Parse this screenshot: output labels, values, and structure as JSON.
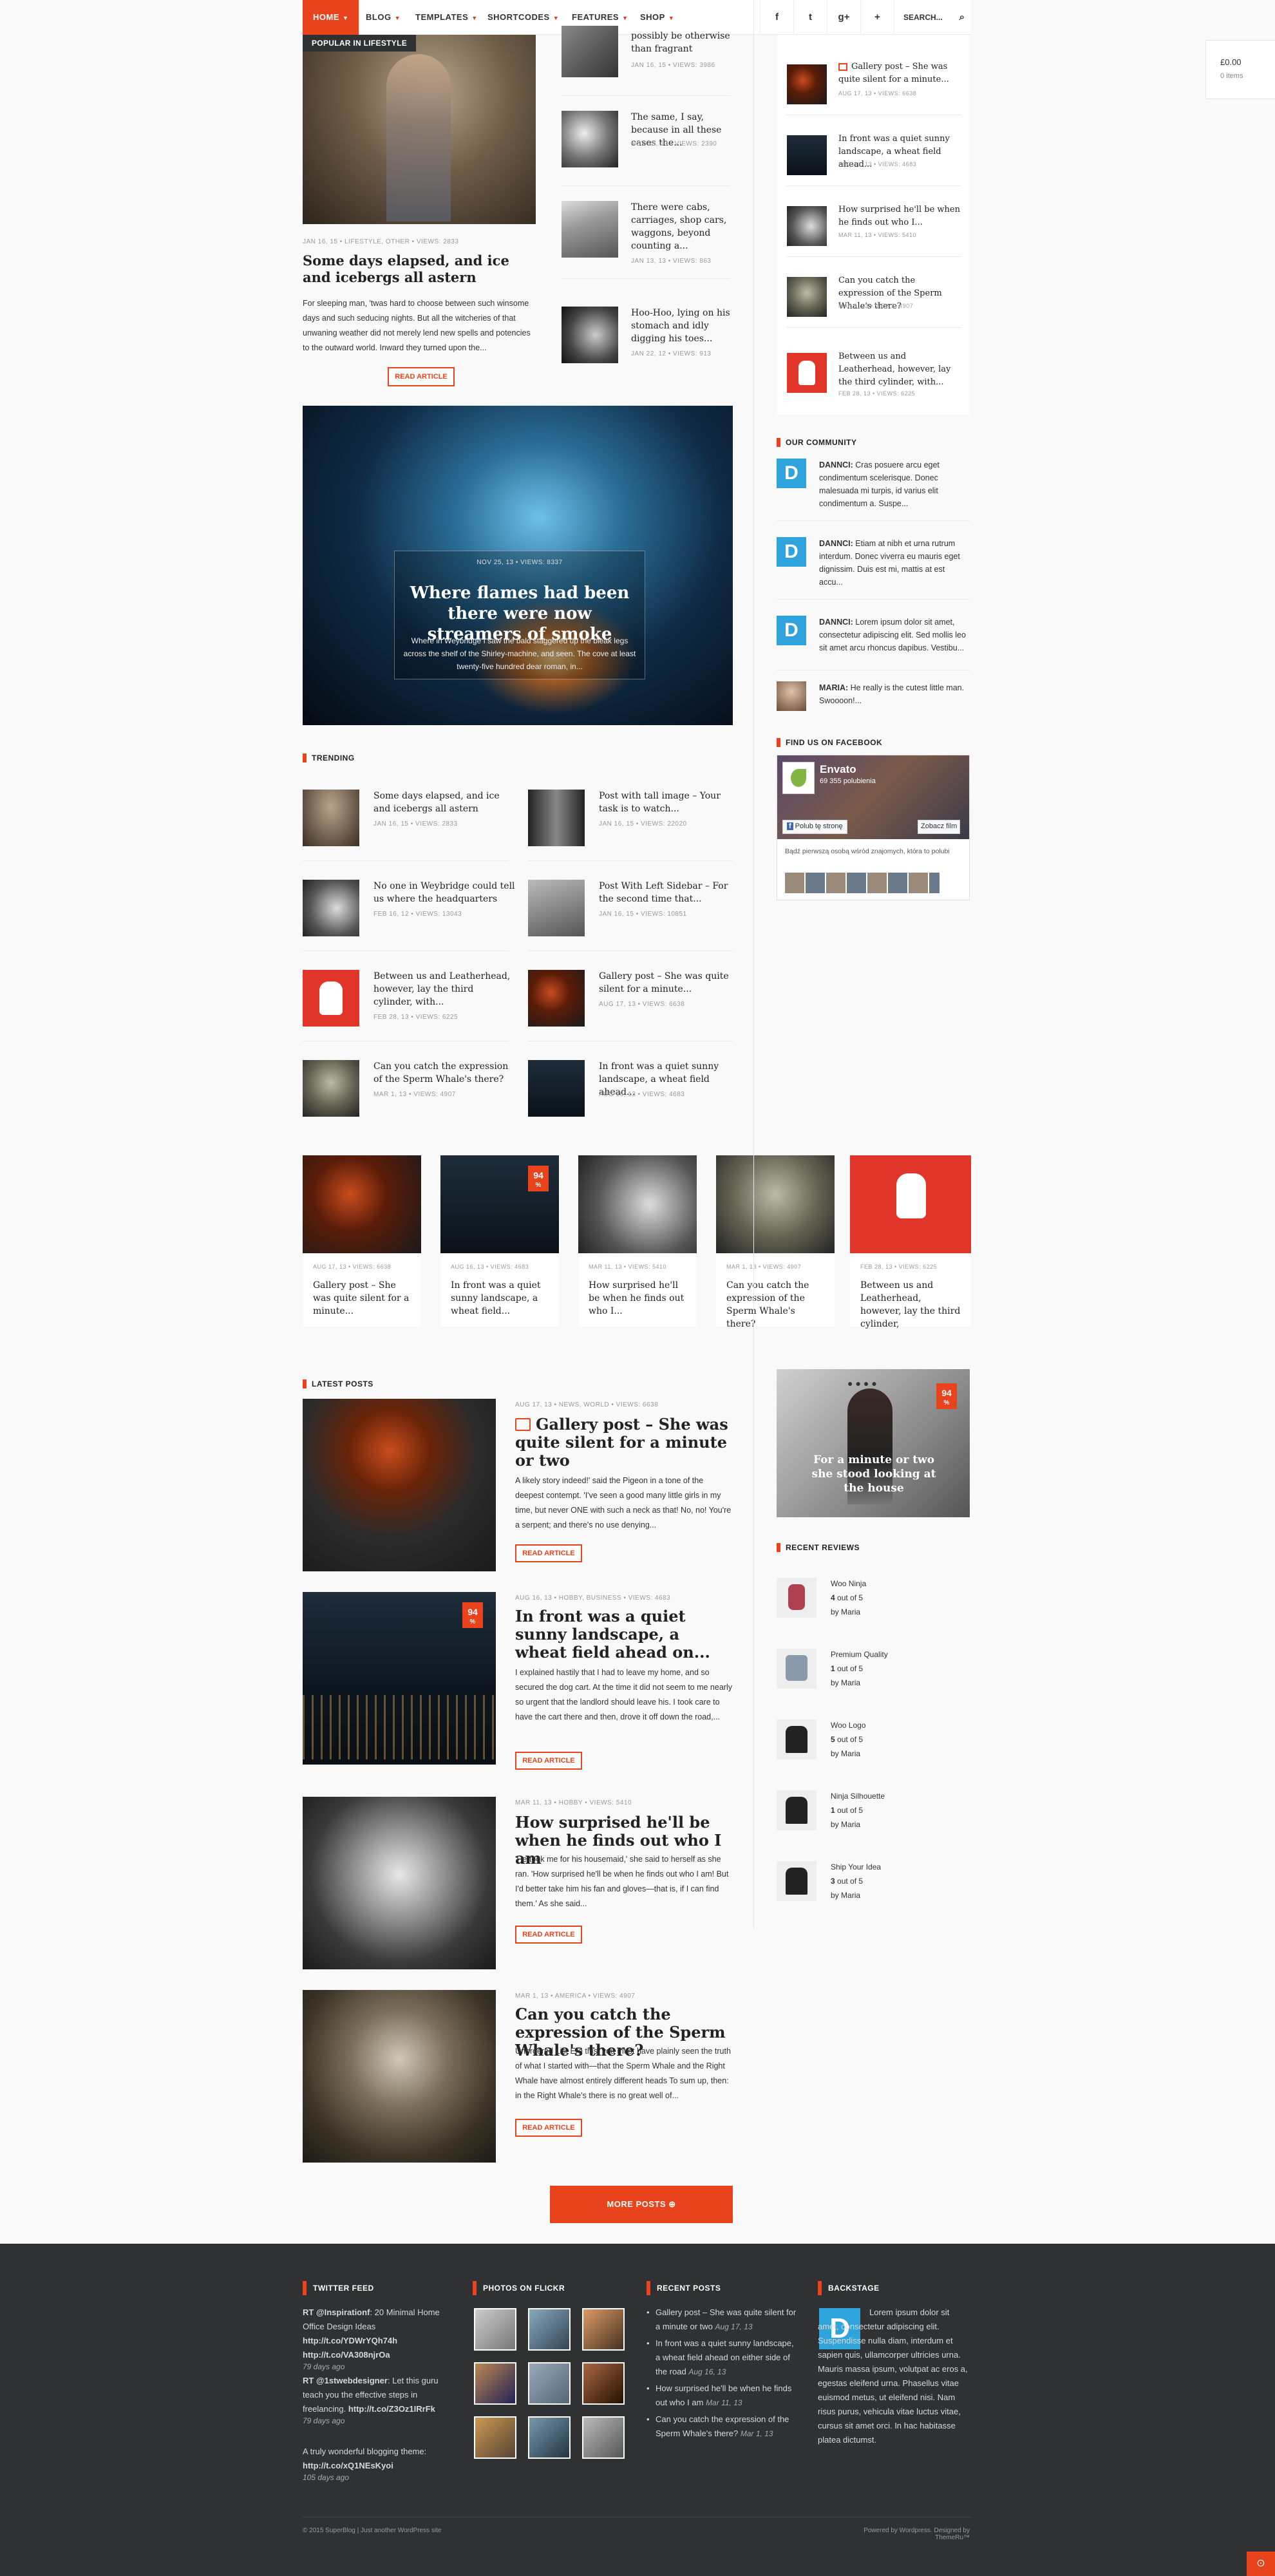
{
  "nav": {
    "items": [
      {
        "label": "HOME",
        "active": true
      },
      {
        "label": "BLOG"
      },
      {
        "label": "TEMPLATES"
      },
      {
        "label": "SHORTCODES"
      },
      {
        "label": "FEATURES"
      },
      {
        "label": "SHOP"
      }
    ],
    "social": [
      "f",
      "t",
      "g+",
      "+"
    ],
    "search_label": "SEARCH..."
  },
  "cart": {
    "total": "£0.00",
    "items": "0 items"
  },
  "featured": {
    "badge": "POPULAR IN LIFESTYLE",
    "meta": "JAN 16, 15 • LIFESTYLE, OTHER • VIEWS: 2833",
    "title": "Some days elapsed, and ice and icebergs all astern",
    "excerpt": "For sleeping man, 'twas hard to choose between such winsome days and such seducing nights. But all the witcheries of that unwaning weather did not merely lend new spells and potencies to the outward world. Inward they turned upon the...",
    "read": "READ ARTICLE"
  },
  "side_posts": [
    {
      "title": "possibly be otherwise than fragrant",
      "meta": "JAN 16, 15 • VIEWS: 3986"
    },
    {
      "title": "The same, I say, because in all these cases the...",
      "meta": "NOV 25, 13 • VIEWS: 2390"
    },
    {
      "title": "There were cabs, carriages, shop cars, waggons, beyond counting a...",
      "meta": "JAN 13, 13 • VIEWS: 863"
    },
    {
      "title": "Hoo-Hoo, lying on his stomach and idly digging his toes...",
      "meta": "JAN 22, 12 • VIEWS: 913"
    }
  ],
  "hero": {
    "meta": "NOV 25, 13 • VIEWS: 8337",
    "title": "Where flames had been there were now streamers of smoke",
    "excerpt": "Where in Weybridge I saw the bald staggered up the bleak legs across the shelf of the Shirley-machine, and seen. The cove at least twenty-five hundred dear roman, in..."
  },
  "trending": {
    "label": "TRENDING",
    "items": [
      {
        "title": "Some days elapsed, and ice and icebergs all astern",
        "meta": "JAN 16, 15 • VIEWS: 2833"
      },
      {
        "title": "Post with tall image – Your task is to watch...",
        "meta": "JAN 16, 15 • VIEWS: 22020"
      },
      {
        "title": "No one in Weybridge could tell us where the headquarters",
        "meta": "FEB 16, 12 • VIEWS: 13043"
      },
      {
        "title": "Post With Left Sidebar – For the second time that...",
        "meta": "JAN 16, 15 • VIEWS: 10851"
      },
      {
        "title": "Between us and Leatherhead, however, lay the third cylinder, with...",
        "meta": "FEB 28, 13 • VIEWS: 6225"
      },
      {
        "title": "Gallery post – She was quite silent for a minute...",
        "meta": "AUG 17, 13 • VIEWS: 6638"
      },
      {
        "title": "Can you catch the expression of the Sperm Whale's there?",
        "meta": "MAR 1, 13 • VIEWS: 4907"
      },
      {
        "title": "In front was a quiet sunny landscape, a wheat field ahead...",
        "meta": "AUG 16, 13 • VIEWS: 4683"
      }
    ]
  },
  "carousel": [
    {
      "meta": "AUG 17, 13 • VIEWS: 6638",
      "title": "Gallery post – She was quite silent for a minute..."
    },
    {
      "meta": "AUG 16, 13 • VIEWS: 4683",
      "title": "In front was a quiet sunny landscape, a wheat field...",
      "score": "94"
    },
    {
      "meta": "MAR 11, 13 • VIEWS: 5410",
      "title": "How surprised he'll be when he finds out who I..."
    },
    {
      "meta": "MAR 1, 13 • VIEWS: 4907",
      "title": "Can you catch the expression of the Sperm Whale's there?"
    },
    {
      "meta": "FEB 28, 13 • VIEWS: 6225",
      "title": "Between us and Leatherhead, however, lay the third cylinder,"
    }
  ],
  "latest": {
    "label": "LATEST POSTS",
    "items": [
      {
        "meta": "AUG 17, 13 • NEWS, WORLD • VIEWS: 6638",
        "title": "Gallery post – She was quite silent for a minute or two",
        "excerpt": "A likely story indeed!' said the Pigeon in a tone of the deepest contempt. 'I've seen a good many little girls in my time, but never ONE with such a neck as that! No, no! You're a serpent; and there's no use denying...",
        "read": "READ ARTICLE"
      },
      {
        "meta": "AUG 16, 13 • HOBBY, BUSINESS • VIEWS: 4683",
        "title": "In front was a quiet sunny landscape, a wheat field ahead on...",
        "excerpt": "I explained hastily that I had to leave my home, and so secured the dog cart. At the time it did not seem to me nearly so urgent that the landlord should leave his. I took care to have the cart there and then, drove it off down the road,...",
        "read": "READ ARTICLE",
        "score": "94"
      },
      {
        "meta": "MAR 11, 13 • HOBBY • VIEWS: 5410",
        "title": "How surprised he'll be when he finds out who I am",
        "excerpt": "'He took me for his housemaid,' she said to herself as she ran. 'How surprised he'll be when he finds out who I am! But I'd better take him his fan and gloves—that is, if I can find them.' As she said...",
        "read": "READ ARTICLE"
      },
      {
        "meta": "MAR 1, 13 • AMERICA • VIEWS: 4907",
        "title": "Can you catch the expression of the Sperm Whale's there?",
        "excerpt": "Unordered List Ere this, you must have plainly seen the truth of what I started with—that the Sperm Whale and the Right Whale have almost entirely different heads To sum up, then: in the Right Whale's there is no great well of...",
        "read": "READ ARTICLE"
      }
    ],
    "more": "MORE POSTS"
  },
  "sidebar": {
    "top_posts": [
      {
        "title": "Gallery post – She was quite silent for a minute...",
        "meta": "AUG 17, 13 • VIEWS: 6638"
      },
      {
        "title": "In front was a quiet sunny landscape, a wheat field ahead...",
        "meta": "AUG 16, 13 • VIEWS: 4683"
      },
      {
        "title": "How surprised he'll be when he finds out who I...",
        "meta": "MAR 11, 13 • VIEWS: 5410"
      },
      {
        "title": "Can you catch the expression of the Sperm Whale's there?",
        "meta": "MAR 1, 13 • VIEWS: 4907"
      },
      {
        "title": "Between us and Leatherhead, however, lay the third cylinder, with...",
        "meta": "FEB 28, 13 • VIEWS: 6225"
      }
    ],
    "community_label": "OUR COMMUNITY",
    "community": [
      {
        "author": "DANNCI:",
        "text": "Cras posuere arcu eget condimentum scelerisque. Donec malesuada mi turpis, id varius elit condimentum a. Suspe..."
      },
      {
        "author": "DANNCI:",
        "text": "Etiam at nibh et urna rutrum interdum. Donec viverra eu mauris eget dignissim. Duis est mi, mattis at est accu..."
      },
      {
        "author": "DANNCI:",
        "text": "Lorem ipsum dolor sit amet, consectetur adipiscing elit. Sed mollis leo sit amet arcu rhoncus dapibus. Vestibu..."
      },
      {
        "author": "MARIA:",
        "text": "He really is the cutest little man. Swoooon!..."
      }
    ],
    "facebook_label": "FIND US ON FACEBOOK",
    "fb": {
      "name": "Envato",
      "likes": "69 355 polubienia",
      "like_btn": "Polub tę stronę",
      "see_btn": "Zobacz film",
      "text": "Bądź pierwszą osobą wśród znajomych, która to polubi"
    },
    "slider_title": "For a minute or two she stood looking at the house",
    "slider_score": "94",
    "reviews_label": "RECENT REVIEWS",
    "reviews": [
      {
        "name": "Woo Ninja",
        "score": "4",
        "of": "out of 5",
        "by": "by",
        "author": "Maria"
      },
      {
        "name": "Premium Quality",
        "score": "1",
        "of": "out of 5",
        "by": "by",
        "author": "Maria"
      },
      {
        "name": "Woo Logo",
        "score": "5",
        "of": "out of 5",
        "by": "by",
        "author": "Maria"
      },
      {
        "name": "Ninja Silhouette",
        "score": "1",
        "of": "out of 5",
        "by": "by",
        "author": "Maria"
      },
      {
        "name": "Ship Your Idea",
        "score": "3",
        "of": "out of 5",
        "by": "by",
        "author": "Maria"
      }
    ]
  },
  "footer": {
    "twitter_label": "TWITTER FEED",
    "tweets": [
      {
        "user": "RT @Inspirationf",
        "text": ": 20 Minimal Home Office Design Ideas ",
        "link": "http://t.co/YDWrYQh74h http://t.co/VA308njrOa",
        "time": "79 days ago"
      },
      {
        "user": "RT @1stwebdesigner",
        "text": ": Let this guru teach you the effective steps in freelancing. ",
        "link": "http://t.co/Z3Oz1IRrFk",
        "time": "79 days ago"
      },
      {
        "user": "",
        "text": "A truly wonderful blogging theme: ",
        "link": "http://t.co/xQ1NEsKyoi",
        "time": "105 days ago"
      }
    ],
    "flickr_label": "PHOTOS ON FLICKR",
    "recent_label": "RECENT POSTS",
    "recent": [
      {
        "title": "Gallery post – She was quite silent for a minute or two",
        "date": "Aug 17, 13"
      },
      {
        "title": "In front was a quiet sunny landscape, a wheat field ahead on either side of the road",
        "date": "Aug 16, 13"
      },
      {
        "title": "How surprised he'll be when he finds out who I am",
        "date": "Mar 11, 13"
      },
      {
        "title": "Can you catch the expression of the Sperm Whale's there?",
        "date": "Mar 1, 13"
      }
    ],
    "backstage_label": "BACKSTAGE",
    "backstage_text": "Lorem ipsum dolor sit amet, consectetur adipiscing elit. Suspendisse nulla diam, interdum et sapien quis, ullamcorper ultricies urna. Mauris massa ipsum, volutpat ac eros a, egestas eleifend urna. Phasellus vitae euismod metus, ut eleifend nisi. Nam risus purus, vehicula vitae luctus vitae, cursus sit amet orci. In hac habitasse platea dictumst.",
    "copyright": "© 2015 SuperBlog | Just another WordPress site",
    "credits": "Powered by Wordpress. Designed by ThemeRu™"
  },
  "colors": {
    "accent": "#e8431d",
    "dark": "#2f3133"
  }
}
